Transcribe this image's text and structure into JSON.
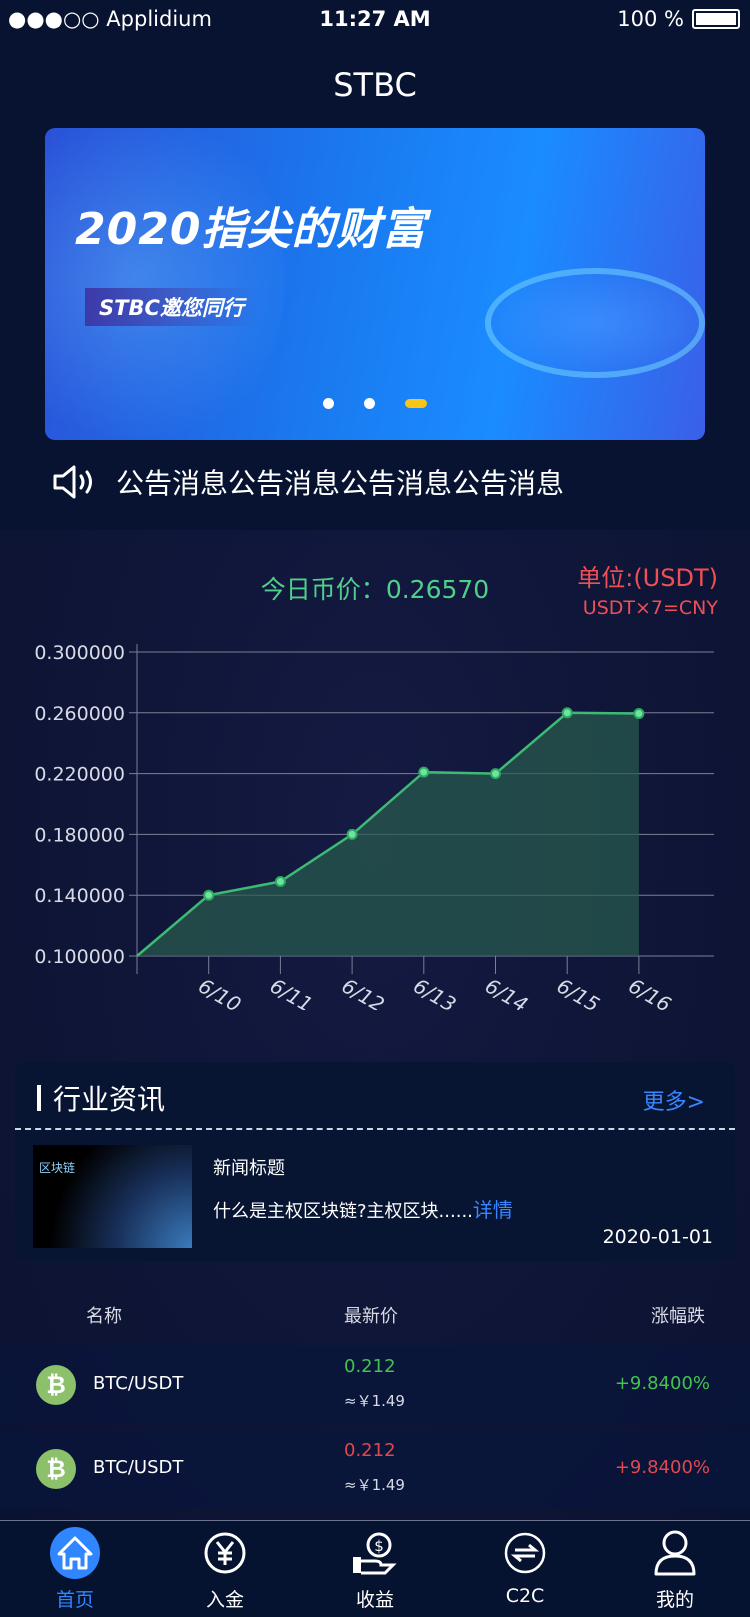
{
  "status_bar": {
    "carrier": "●●●○○ Applidium",
    "time": "11:27 AM",
    "battery": "100 %"
  },
  "header": {
    "title": "STBC"
  },
  "banner": {
    "headline": "2020指尖的财富",
    "subline": "STBC邀您同行",
    "slides": 3,
    "active_slide": 3
  },
  "notice": {
    "text": "公告消息公告消息公告消息公告消息",
    "icon": "speaker-icon"
  },
  "price": {
    "label": "今日币价：",
    "value": "0.26570",
    "unit": "单位:(USDT)",
    "conversion": "USDT×7=CNY"
  },
  "chart_data": {
    "type": "area",
    "categories": [
      "",
      "6/10",
      "6/11",
      "6/12",
      "6/13",
      "6/14",
      "6/15",
      "6/16"
    ],
    "values": [
      0.1,
      0.14,
      0.149,
      0.18,
      0.221,
      0.22,
      0.26,
      0.2595
    ],
    "yticks": [
      "0.100000",
      "0.140000",
      "0.180000",
      "0.220000",
      "0.260000",
      "0.300000"
    ],
    "ylim": [
      0.1,
      0.3
    ],
    "grid": true,
    "line_color": "#3dba74",
    "fill_color": "#2a5e4f"
  },
  "news": {
    "title": "行业资讯",
    "more": "更多>",
    "thumb_label": "区块链",
    "items": [
      {
        "title": "新闻标题",
        "summary": "什么是主权区块链?主权区块......",
        "link": "详情",
        "date": "2020-01-01"
      }
    ]
  },
  "market": {
    "headers": [
      "名称",
      "最新价",
      "涨幅跌"
    ],
    "rows": [
      {
        "pair": "BTC/USDT",
        "price": "0.212",
        "cny": "≈￥1.49",
        "change": "+9.8400%",
        "trend": "up"
      },
      {
        "pair": "BTC/USDT",
        "price": "0.212",
        "cny": "≈￥1.49",
        "change": "+9.8400%",
        "trend": "down"
      }
    ]
  },
  "tabbar": [
    {
      "label": "首页",
      "icon": "home-icon",
      "active": true
    },
    {
      "label": "入金",
      "icon": "yen-icon"
    },
    {
      "label": "收益",
      "icon": "earnings-icon"
    },
    {
      "label": "C2C",
      "icon": "exchange-icon"
    },
    {
      "label": "我的",
      "icon": "user-icon"
    }
  ],
  "colors": {
    "accent": "#2f86ff",
    "up": "#44c14e",
    "down": "#e0484f",
    "price": "#4fcf8a"
  }
}
